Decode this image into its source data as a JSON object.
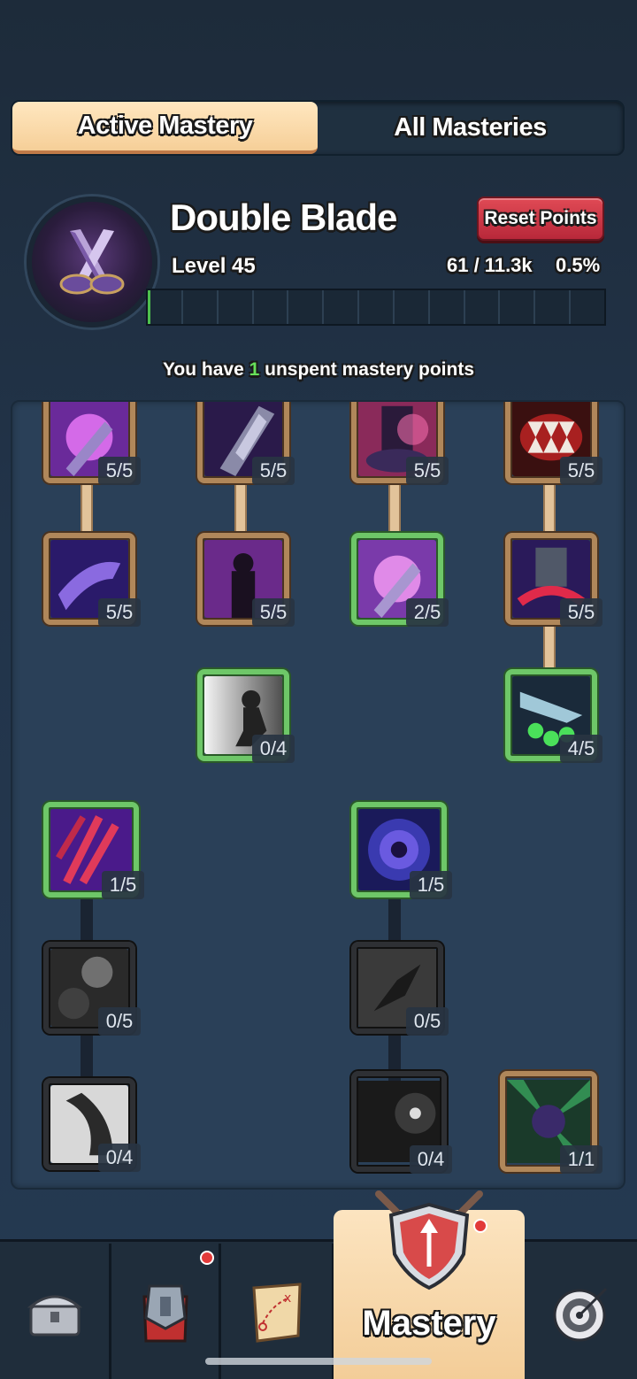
{
  "tabs": {
    "active": "Active Mastery",
    "other": "All Masteries"
  },
  "mastery": {
    "name": "Double Blade",
    "level": "Level 45",
    "xp": "61 / 11.3k",
    "percent": "0.5%",
    "progress_fraction": 0.005,
    "reset_label": "Reset Points"
  },
  "unspent": {
    "prefix": "You have",
    "count": "1",
    "suffix": "unspent mastery points"
  },
  "nodes": [
    {
      "count": "5/5"
    },
    {
      "count": "5/5"
    },
    {
      "count": "5/5"
    },
    {
      "count": "5/5"
    },
    {
      "count": "5/5"
    },
    {
      "count": "5/5"
    },
    {
      "count": "2/5"
    },
    {
      "count": "5/5"
    },
    {
      "count": "0/4"
    },
    {
      "count": "4/5"
    },
    {
      "count": "1/5"
    },
    {
      "count": "1/5"
    },
    {
      "count": "0/5"
    },
    {
      "count": "0/5"
    },
    {
      "count": "0/4"
    },
    {
      "count": "0/4"
    },
    {
      "count": "1/1"
    }
  ],
  "nav": {
    "active_label": "Mastery",
    "items": [
      "chest-icon",
      "armor-icon",
      "map-icon",
      "mastery-icon",
      "target-icon"
    ]
  },
  "colors": {
    "accent_green": "#67e05a",
    "reset_red": "#c8303f",
    "tab_active": "#f6cf98"
  }
}
